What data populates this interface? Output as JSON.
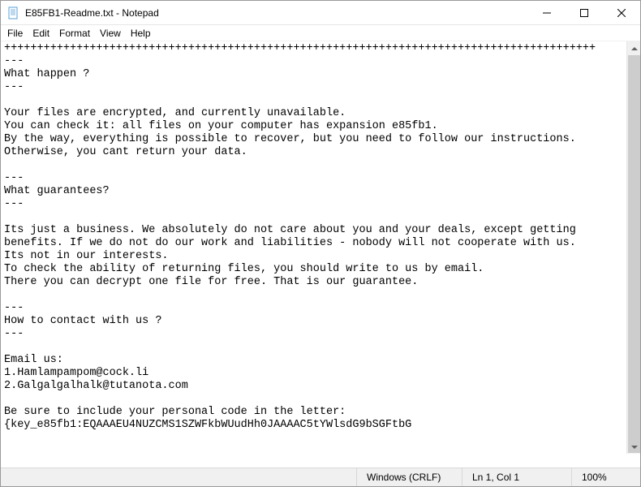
{
  "titlebar": {
    "title": "E85FB1-Readme.txt - Notepad"
  },
  "menu": {
    "file": "File",
    "edit": "Edit",
    "format": "Format",
    "view": "View",
    "help": "Help"
  },
  "editor": {
    "content": "++++++++++++++++++++++++++++++++++++++++++++++++++++++++++++++++++++++++++++++++++++++++++\n---\nWhat happen ?\n---\n\nYour files are encrypted, and currently unavailable.\nYou can check it: all files on your computer has expansion e85fb1.\nBy the way, everything is possible to recover, but you need to follow our instructions.\nOtherwise, you cant return your data.\n\n---\nWhat guarantees?\n---\n\nIts just a business. We absolutely do not care about you and your deals, except getting\nbenefits. If we do not do our work and liabilities - nobody will not cooperate with us.\nIts not in our interests.\nTo check the ability of returning files, you should write to us by email.\nThere you can decrypt one file for free. That is our guarantee.\n\n---\nHow to contact with us ?\n---\n\nEmail us:\n1.Hamlampampom@cock.li\n2.Galgalgalhalk@tutanota.com\n\nBe sure to include your personal code in the letter:\n{key_e85fb1:EQAAAEU4NUZCMS1SZWFkbWUudHh0JAAAAC5tYWlsdG9bSGFtbG"
  },
  "statusbar": {
    "lineending": "Windows (CRLF)",
    "position": "Ln 1, Col 1",
    "zoom": "100%"
  }
}
